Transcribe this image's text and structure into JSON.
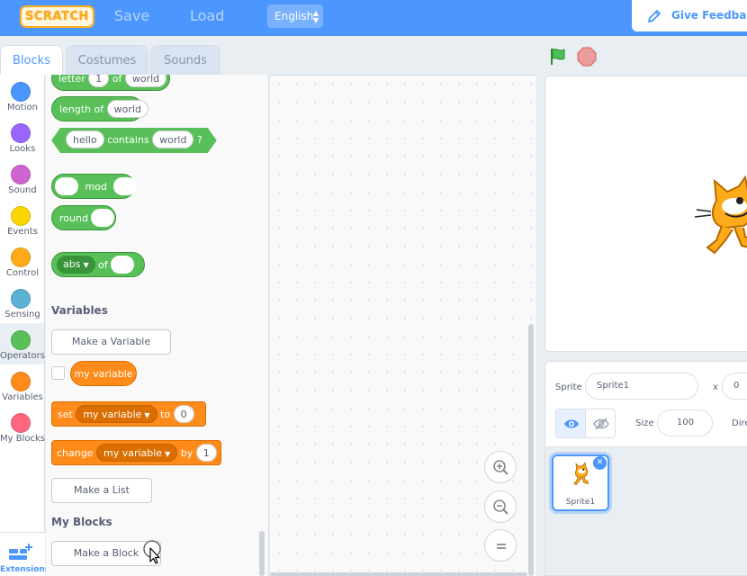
{
  "menubar": {
    "logo": "SCRATCH",
    "save_label": "Save",
    "load_label": "Load",
    "language": "English",
    "feedback_label": "Give Feedback",
    "color": "#4c97ff"
  },
  "tabs": [
    {
      "label": "Blocks",
      "active": true
    },
    {
      "label": "Costumes",
      "active": false
    },
    {
      "label": "Sounds",
      "active": false
    }
  ],
  "categories": [
    {
      "label": "Motion",
      "color": "#4c97ff"
    },
    {
      "label": "Looks",
      "color": "#9966ff"
    },
    {
      "label": "Sound",
      "color": "#cf63cf"
    },
    {
      "label": "Events",
      "color": "#ffd500"
    },
    {
      "label": "Control",
      "color": "#ffab19"
    },
    {
      "label": "Sensing",
      "color": "#5cb1d6"
    },
    {
      "label": "Operators",
      "color": "#59c059",
      "selected": true
    },
    {
      "label": "Variables",
      "color": "#ff8c1a"
    },
    {
      "label": "My Blocks",
      "color": "#ff6680"
    }
  ],
  "extensions_label": "Extensions",
  "blocks": {
    "letter": {
      "word1": "letter",
      "num": "1",
      "word2": "of",
      "value": "world"
    },
    "length": {
      "label": "length of",
      "value": "world"
    },
    "contains": {
      "value1": "hello",
      "label": "contains",
      "value2": "world",
      "suffix": "?"
    },
    "mod": {
      "label": "mod"
    },
    "round": {
      "label": "round"
    },
    "abs": {
      "func": "abs",
      "label": "of"
    },
    "variables_heading": "Variables",
    "make_variable": "Make a Variable",
    "my_variable": "my variable",
    "set": {
      "label": "set",
      "var": "my variable",
      "to": "to",
      "value": "0"
    },
    "change": {
      "label": "change",
      "var": "my variable",
      "by": "by",
      "value": "1"
    },
    "make_list": "Make a List",
    "my_blocks_heading": "My Blocks",
    "make_block": "Make a Block"
  },
  "sprite_info": {
    "sprite_label": "Sprite",
    "sprite_name": "Sprite1",
    "x_label": "x",
    "x_value": "0",
    "size_label": "Size",
    "size_value": "100",
    "direction_label": "Dire"
  },
  "sprites": [
    {
      "name": "Sprite1",
      "selected": true
    }
  ]
}
